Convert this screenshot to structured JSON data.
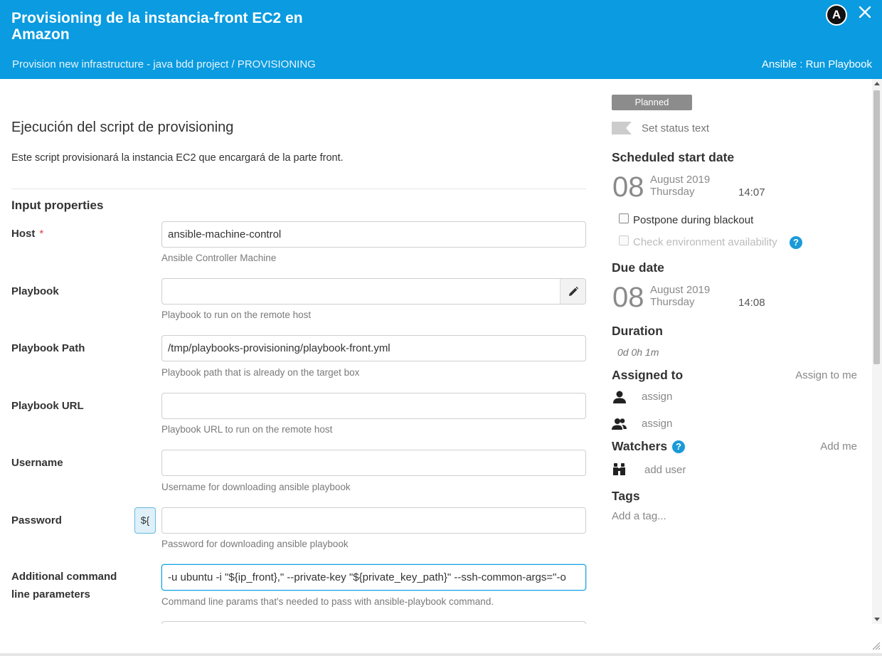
{
  "header": {
    "title": "Provisioning de la instancia-front EC2 en Amazon",
    "breadcrumb": "Provision new infrastructure - java bdd project / PROVISIONING",
    "task_type": "Ansible : Run Playbook",
    "logo_letter": "A",
    "close_glyph": "✕"
  },
  "task": {
    "title": "Ejecución del script de provisioning",
    "description": "Este script provisionará la instancia EC2 que encargará de la parte front."
  },
  "input_properties": {
    "section_title": "Input properties",
    "required_mark": "*",
    "var_button_label": "${",
    "fields": [
      {
        "label": "Host",
        "value": "ansible-machine-control",
        "help": "Ansible Controller Machine"
      },
      {
        "label": "Playbook",
        "value": "",
        "help": "Playbook to run on the remote host"
      },
      {
        "label": "Playbook Path",
        "value": "/tmp/playbooks-provisioning/playbook-front.yml",
        "help": "Playbook path that is already on the target box"
      },
      {
        "label": "Playbook URL",
        "value": "",
        "help": "Playbook URL to run on the remote host"
      },
      {
        "label": "Username",
        "value": "",
        "help": "Username for downloading ansible playbook"
      },
      {
        "label": "Password",
        "value": "",
        "help": "Password for downloading ansible playbook"
      },
      {
        "label_line1": "Additional command",
        "label_line2": "line parameters",
        "value": "-u ubuntu -i \"${ip_front},\" --private-key \"${private_key_path}\" --ssh-common-args=\"-o",
        "help": "Command line params that's needed to pass with ansible-playbook command."
      }
    ]
  },
  "sidebar": {
    "status": "Planned",
    "set_status_text": "Set status text",
    "scheduled": {
      "heading": "Scheduled start date",
      "day": "08",
      "month_year": "August 2019",
      "weekday": "Thursday",
      "time": "14:07"
    },
    "postpone_label": "Postpone during blackout",
    "check_env_label": "Check environment availability",
    "help_glyph": "?",
    "due": {
      "heading": "Due date",
      "day": "08",
      "month_year": "August 2019",
      "weekday": "Thursday",
      "time": "14:08"
    },
    "duration": {
      "heading": "Duration",
      "value": "0d 0h 1m"
    },
    "assigned": {
      "heading": "Assigned to",
      "assign_me": "Assign to me",
      "user_placeholder": "assign",
      "team_placeholder": "assign"
    },
    "watchers": {
      "heading": "Watchers",
      "add_me": "Add me",
      "add_user": "add user"
    },
    "tags": {
      "heading": "Tags",
      "placeholder": "Add a tag..."
    }
  }
}
